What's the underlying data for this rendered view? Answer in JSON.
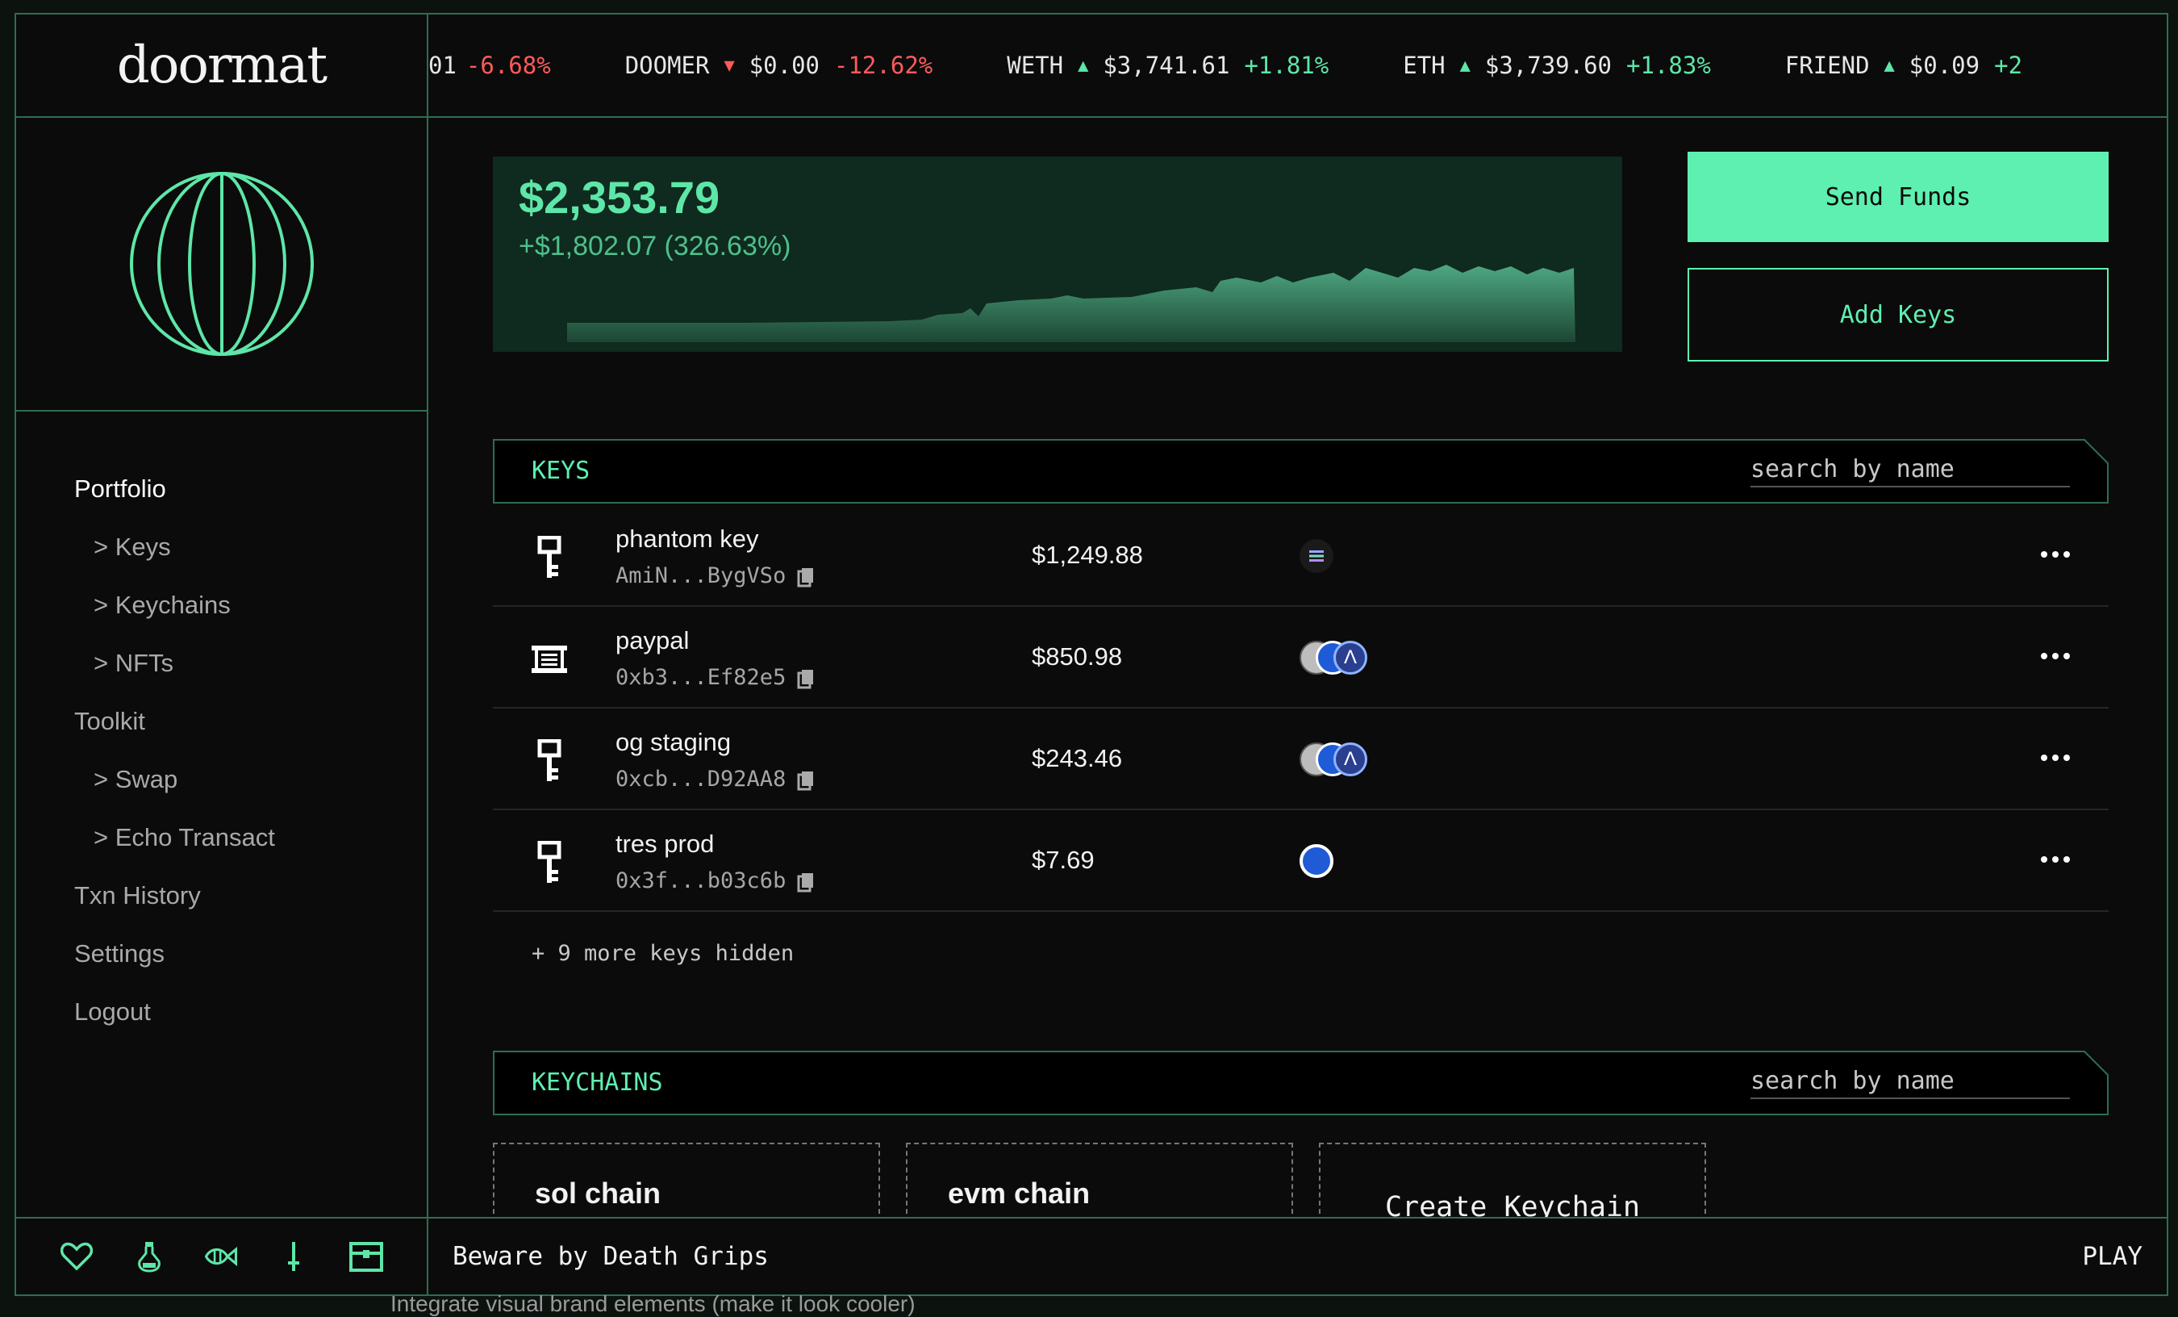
{
  "app": {
    "logo": "doormat"
  },
  "ticker": [
    {
      "symbol": "",
      "arrow": "",
      "price": "01",
      "change": "-6.68%",
      "direction": "down"
    },
    {
      "symbol": "DOOMER",
      "arrow": "▼",
      "price": "$0.00",
      "change": "-12.62%",
      "direction": "down"
    },
    {
      "symbol": "WETH",
      "arrow": "▲",
      "price": "$3,741.61",
      "change": "+1.81%",
      "direction": "up"
    },
    {
      "symbol": "ETH",
      "arrow": "▲",
      "price": "$3,739.60",
      "change": "+1.83%",
      "direction": "up"
    },
    {
      "symbol": "FRIEND",
      "arrow": "▲",
      "price": "$0.09",
      "change": "+2",
      "direction": "up"
    }
  ],
  "sidebar": {
    "items": [
      {
        "label": "Portfolio",
        "active": true
      },
      {
        "label": "> Keys"
      },
      {
        "label": "> Keychains"
      },
      {
        "label": "> NFTs"
      },
      {
        "label": "Toolkit"
      },
      {
        "label": "> Swap"
      },
      {
        "label": "> Echo Transact"
      },
      {
        "label": "Txn History"
      },
      {
        "label": "Settings"
      },
      {
        "label": "Logout"
      }
    ],
    "footer_icons": [
      "heart-icon",
      "potion-icon",
      "fish-icon",
      "sword-icon",
      "chest-icon"
    ]
  },
  "balance": {
    "value": "$2,353.79",
    "change": "+$1,802.07 (326.63%)"
  },
  "actions": {
    "send": "Send Funds",
    "add_keys": "Add Keys"
  },
  "keys_section": {
    "title": "KEYS",
    "search_placeholder": "search by name"
  },
  "keys": [
    {
      "name": "phantom key",
      "address": "AmiN...BygVSo",
      "value": "$1,249.88",
      "icon": "key-icon",
      "chains": [
        "solana"
      ]
    },
    {
      "name": "paypal",
      "address": "0xb3...Ef82e5",
      "value": "$850.98",
      "icon": "scroll-icon",
      "chains": [
        "ethereum",
        "base",
        "arbitrum"
      ]
    },
    {
      "name": "og staging",
      "address": "0xcb...D92AA8",
      "value": "$243.46",
      "icon": "key-icon",
      "chains": [
        "ethereum",
        "base",
        "arbitrum"
      ]
    },
    {
      "name": "tres prod",
      "address": "0x3f...b03c6b",
      "value": "$7.69",
      "icon": "key-icon",
      "chains": [
        "base"
      ]
    }
  ],
  "more_keys": "+ 9 more keys hidden",
  "keychains_section": {
    "title": "KEYCHAINS",
    "search_placeholder": "search by name"
  },
  "keychains": [
    {
      "name": "sol chain"
    },
    {
      "name": "evm chain"
    }
  ],
  "create_keychain": "Create Keychain",
  "player": {
    "track": "Beware by Death Grips",
    "play": "PLAY"
  },
  "caption": "Integrate visual brand elements (make it look cooler)",
  "colors": {
    "accent": "#5ef0b0",
    "border": "#2f6d50",
    "up": "#5ee6a8",
    "down": "#ff5a5a"
  }
}
